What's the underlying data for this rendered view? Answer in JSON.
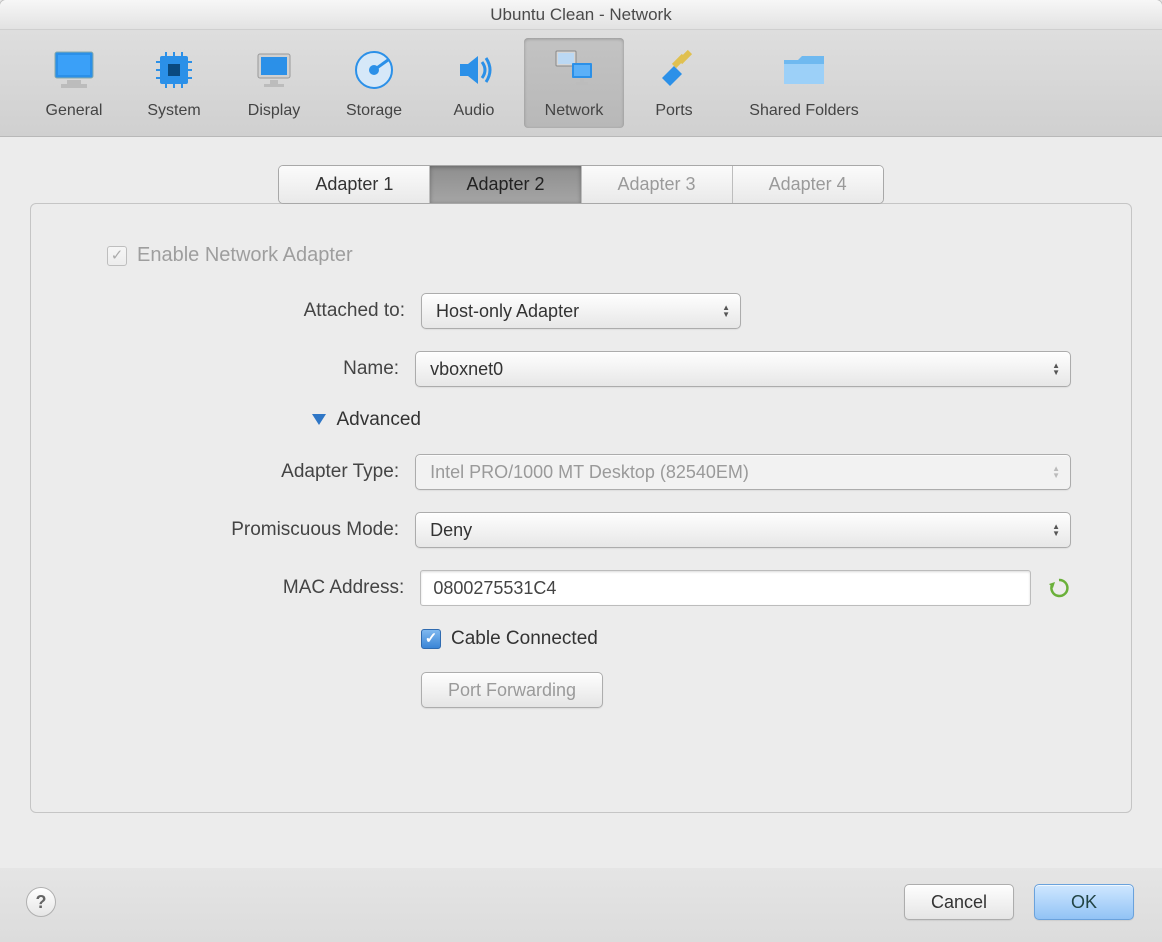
{
  "window_title": "Ubuntu Clean - Network",
  "toolbar": [
    {
      "label": "General"
    },
    {
      "label": "System"
    },
    {
      "label": "Display"
    },
    {
      "label": "Storage"
    },
    {
      "label": "Audio"
    },
    {
      "label": "Network"
    },
    {
      "label": "Ports"
    },
    {
      "label": "Shared Folders"
    }
  ],
  "tabs": [
    {
      "label": "Adapter 1"
    },
    {
      "label": "Adapter 2"
    },
    {
      "label": "Adapter 3"
    },
    {
      "label": "Adapter 4"
    }
  ],
  "form": {
    "enable_label": "Enable Network Adapter",
    "enable_checked": true,
    "attached_to": {
      "label": "Attached to:",
      "value": "Host-only Adapter"
    },
    "name": {
      "label": "Name:",
      "value": "vboxnet0"
    },
    "advanced_label": "Advanced",
    "adapter_type": {
      "label": "Adapter Type:",
      "value": "Intel PRO/1000 MT Desktop (82540EM)"
    },
    "promiscuous": {
      "label": "Promiscuous Mode:",
      "value": "Deny"
    },
    "mac": {
      "label": "MAC Address:",
      "value": "0800275531C4"
    },
    "cable_label": "Cable Connected",
    "cable_checked": true,
    "port_forwarding": "Port Forwarding"
  },
  "footer": {
    "cancel": "Cancel",
    "ok": "OK"
  }
}
